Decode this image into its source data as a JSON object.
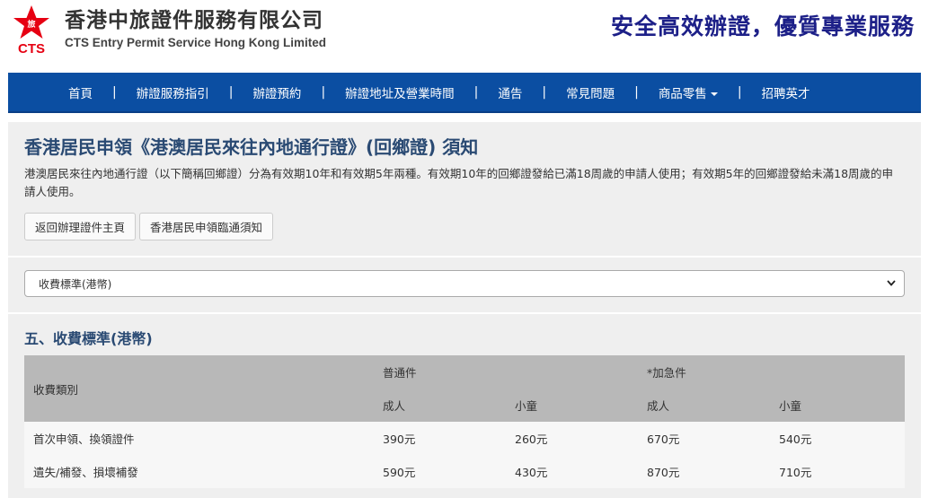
{
  "header": {
    "logo_text": "CTS",
    "company_name_zh": "香港中旅證件服務有限公司",
    "company_name_en": "CTS Entry Permit Service Hong Kong Limited",
    "slogan": "安全高效辦證，優質專業服務"
  },
  "nav": {
    "items": [
      {
        "label": "首頁"
      },
      {
        "label": "辦證服務指引"
      },
      {
        "label": "辦證預約"
      },
      {
        "label": "辦證地址及營業時間"
      },
      {
        "label": "通告"
      },
      {
        "label": "常見問題"
      },
      {
        "label": "商品零售",
        "has_dropdown": true
      },
      {
        "label": "招聘英才"
      }
    ],
    "separator": "|"
  },
  "main": {
    "title": "香港居民申領《港澳居民來往內地通行證》(回鄉證) 須知",
    "intro": "港澳居民來往內地通行證（以下簡稱回鄉證）分為有效期10年和有效期5年兩種。有效期10年的回鄉證發給已滿18周歲的申請人使用；有效期5年的回鄉證發給未滿18周歲的申請人使用。",
    "buttons": {
      "back": "返回辦理證件主頁",
      "notice": "香港居民申領臨通須知"
    }
  },
  "section_select": {
    "selected": "收費標準(港幣)"
  },
  "fees": {
    "section_title": "五、收費標準(港幣)",
    "header": {
      "category": "收費類別",
      "normal": "普通件",
      "urgent": "*加急件",
      "adult": "成人",
      "child": "小童"
    },
    "rows": [
      {
        "category": "首次申領、換領證件",
        "normal_adult": "390元",
        "normal_child": "260元",
        "urgent_adult": "670元",
        "urgent_child": "540元"
      },
      {
        "category": "遺失/補發、損壞補發",
        "normal_adult": "590元",
        "normal_child": "430元",
        "urgent_adult": "870元",
        "urgent_child": "710元"
      }
    ]
  },
  "colors": {
    "nav_bg": "#0b4ea2",
    "slogan": "#1d2088",
    "title": "#2a4a73",
    "logo_red": "#e60012"
  }
}
